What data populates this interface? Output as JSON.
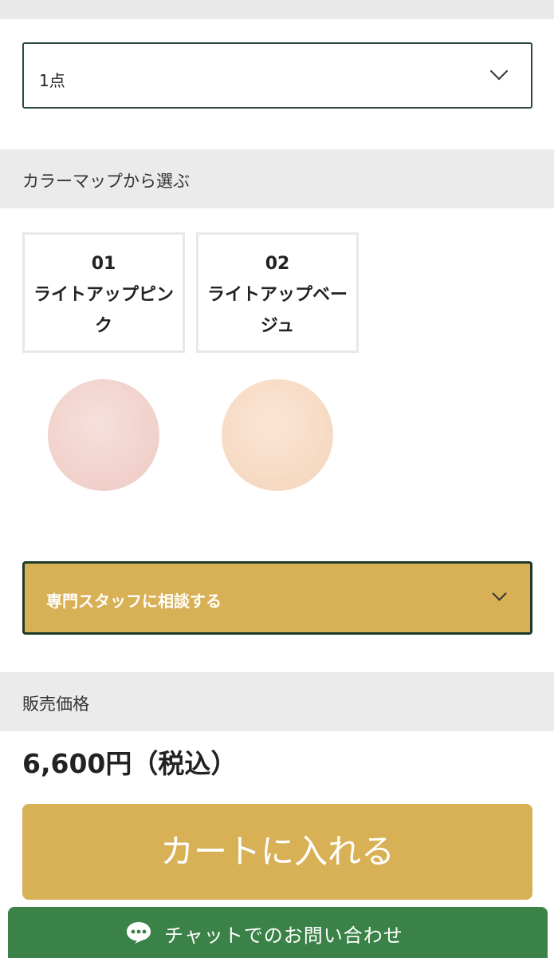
{
  "quantity": {
    "selected": "1点"
  },
  "color_section": {
    "title": "カラーマップから選ぶ",
    "options": [
      {
        "number": "01",
        "name": "ライトアップピンク",
        "swatch_color": "#f2d3cd"
      },
      {
        "number": "02",
        "name": "ライトアップベージュ",
        "swatch_color": "#f7dcc6"
      }
    ]
  },
  "consult": {
    "label": "専門スタッフに相談する"
  },
  "price_section": {
    "title": "販売価格",
    "price": "6,600円（税込）"
  },
  "cart": {
    "label": "カートに入れる"
  },
  "chat": {
    "label": "チャットでのお問い合わせ"
  },
  "colors": {
    "accent_gold": "#d8b055",
    "border_dark_green": "#2f4a38",
    "chat_green": "#3b8248",
    "section_gray": "#ebebeb"
  },
  "icons": {
    "select_arrow": "chevron-down-icon",
    "chat": "chat-bubble-icon"
  }
}
